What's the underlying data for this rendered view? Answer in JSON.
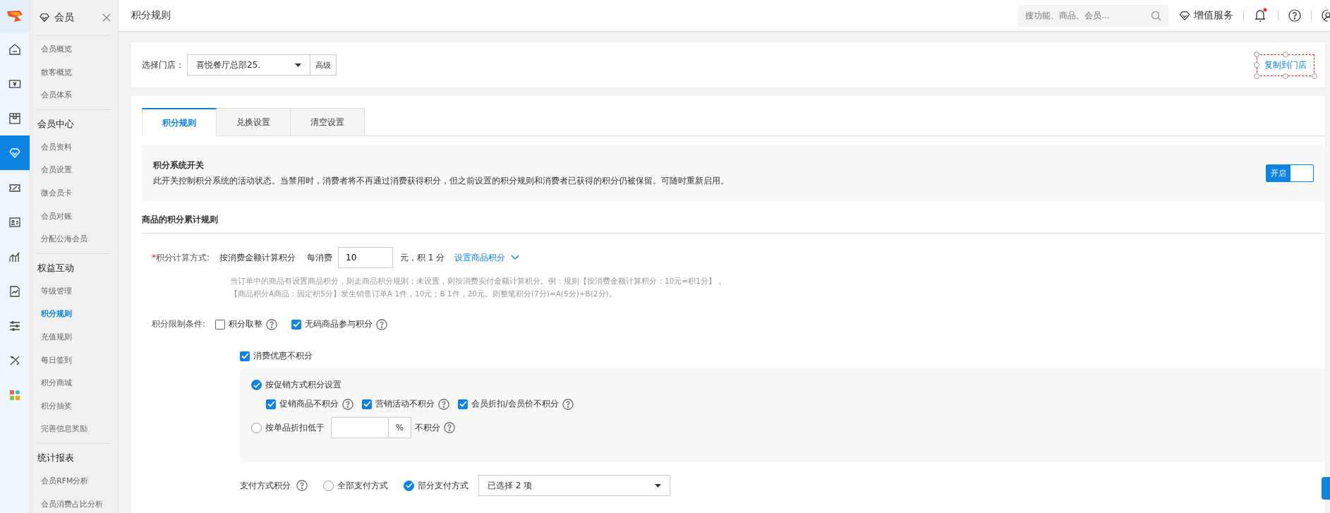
{
  "rail": {
    "items": [
      {
        "kind": "home",
        "selected": false
      },
      {
        "kind": "cash",
        "selected": false
      },
      {
        "kind": "box",
        "selected": false
      },
      {
        "kind": "diamond",
        "selected": true
      },
      {
        "kind": "ticket",
        "selected": false
      },
      {
        "kind": "idcard",
        "selected": false
      },
      {
        "kind": "chart",
        "selected": false
      },
      {
        "kind": "report",
        "selected": false
      },
      {
        "kind": "sliders",
        "selected": false
      },
      {
        "kind": "tools",
        "selected": false
      },
      {
        "kind": "apps",
        "selected": false
      }
    ]
  },
  "sidebar": {
    "title": "会员",
    "sections": [
      {
        "items": [
          {
            "label": "会员概览",
            "selected": false
          },
          {
            "label": "散客概览",
            "selected": false
          },
          {
            "label": "会员体系",
            "selected": false
          }
        ]
      },
      {
        "heading": "会员中心",
        "items": [
          {
            "label": "会员资料",
            "selected": false
          },
          {
            "label": "会员设置",
            "selected": false
          },
          {
            "label": "微会员卡",
            "selected": false
          },
          {
            "label": "会员对账",
            "selected": false
          },
          {
            "label": "分配公海会员",
            "selected": false
          }
        ]
      },
      {
        "heading": "权益互动",
        "items": [
          {
            "label": "等级管理",
            "selected": false
          },
          {
            "label": "积分规则",
            "selected": true
          },
          {
            "label": "充值规则",
            "selected": false
          },
          {
            "label": "每日签到",
            "selected": false
          },
          {
            "label": "积分商城",
            "selected": false
          },
          {
            "label": "积分抽奖",
            "selected": false
          },
          {
            "label": "完善信息奖励",
            "selected": false
          }
        ]
      },
      {
        "heading": "统计报表",
        "items": [
          {
            "label": "会员RFM分析",
            "selected": false
          },
          {
            "label": "会员消费占比分析",
            "selected": false
          }
        ]
      }
    ]
  },
  "header": {
    "title": "积分规则",
    "search": {
      "placeholder": "搜功能、商品、会员..."
    },
    "service": "增值服务",
    "notifications_unread": true
  },
  "store": {
    "label": "选择门店：",
    "value": "喜悦餐厅总部25.",
    "advanced": "高级",
    "copy": "复制到门店",
    "copy_selected": true
  },
  "tabs": [
    {
      "label": "积分规则",
      "selected": true
    },
    {
      "label": "兑换设置",
      "selected": false
    },
    {
      "label": "清空设置",
      "selected": false
    }
  ],
  "system_switch": {
    "title": "积分系统开关",
    "description": "此开关控制积分系统的活动状态。当禁用时，消费者将不再通过消费获得积分，但之前设置的积分规则和消费者已获得的积分仍被保留。可随时重新启用。",
    "label": "开启",
    "on": true
  },
  "section_title": "商品的积分累计规则",
  "calc": {
    "label": "积分计算方式:",
    "required_mark": "*",
    "method": "按消费金额计算积分",
    "per": "每消费",
    "value": "10",
    "unit": "元，积 1 分",
    "link": "设置商品积分",
    "hints": [
      "当订单中的商品有设置商品积分，则走商品积分规则；未设置，则按消费实付金额计算积分。例：规则【按消费金额计算积分：10元=积1分】，",
      "【商品积分A商品：固定积5分】发生销售订单A 1件，10元；B 1件，20元。则整笔积分(7分)=A(5分)+B(2分)。"
    ]
  },
  "limits": {
    "label": "积分限制条件:",
    "options": [
      {
        "label": "积分取整",
        "checked": false
      },
      {
        "label": "无码商品参与积分",
        "checked": true
      }
    ]
  },
  "discount": {
    "label": "消费优惠不积分",
    "checked": true,
    "modes": [
      {
        "kind": "checks",
        "label": "按促销方式积分设置",
        "selected": true,
        "options": [
          {
            "label": "促销商品不积分",
            "checked": true
          },
          {
            "label": "营销活动不积分",
            "checked": true
          },
          {
            "label": "会员折扣/会员价不积分",
            "checked": true
          }
        ]
      },
      {
        "kind": "threshold",
        "label": "按单品折扣低于",
        "selected": false,
        "suffix": "%",
        "after": "不积分"
      }
    ]
  },
  "payment": {
    "label": "支付方式积分",
    "options": [
      {
        "label": "全部支付方式",
        "selected": false
      },
      {
        "label": "部分支付方式",
        "selected": true
      }
    ],
    "select": "已选择 2 项"
  }
}
